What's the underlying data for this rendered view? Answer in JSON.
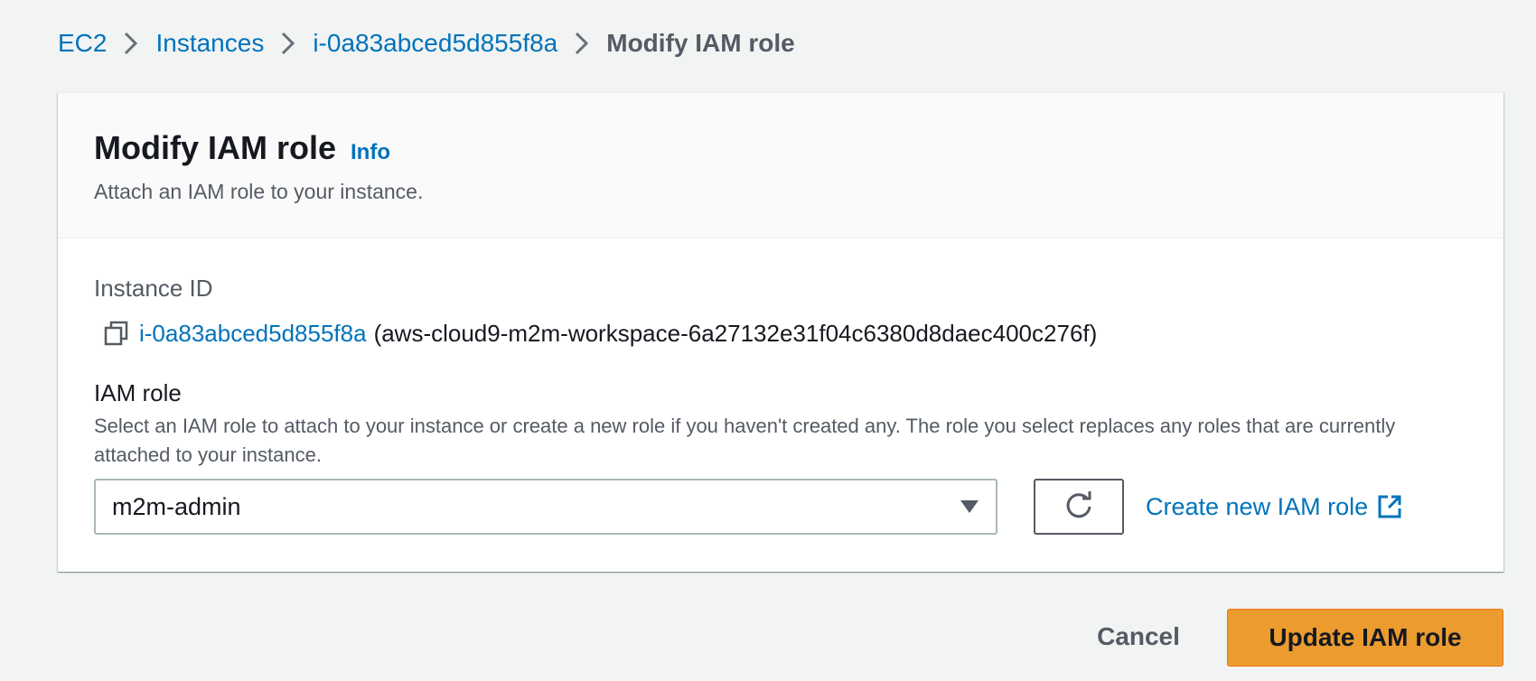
{
  "breadcrumb": {
    "items": [
      "EC2",
      "Instances",
      "i-0a83abced5d855f8a"
    ],
    "current": "Modify IAM role"
  },
  "header": {
    "title": "Modify IAM role",
    "info_label": "Info",
    "description": "Attach an IAM role to your instance."
  },
  "instance": {
    "label": "Instance ID",
    "id": "i-0a83abced5d855f8a",
    "name": "(aws-cloud9-m2m-workspace-6a27132e31f04c6380d8daec400c276f)"
  },
  "iam_role": {
    "label": "IAM role",
    "description": "Select an IAM role to attach to your instance or create a new role if you haven't created any. The role you select replaces any roles that are currently attached to your instance.",
    "selected": "m2m-admin",
    "create_link": "Create new IAM role"
  },
  "actions": {
    "cancel": "Cancel",
    "submit": "Update IAM role"
  },
  "colors": {
    "link": "#0073bb",
    "primary": "#ec9c2f",
    "background": "#f2f3f3"
  },
  "icons": [
    "chevron-right-icon",
    "copy-icon",
    "caret-down-icon",
    "refresh-icon",
    "external-link-icon"
  ]
}
